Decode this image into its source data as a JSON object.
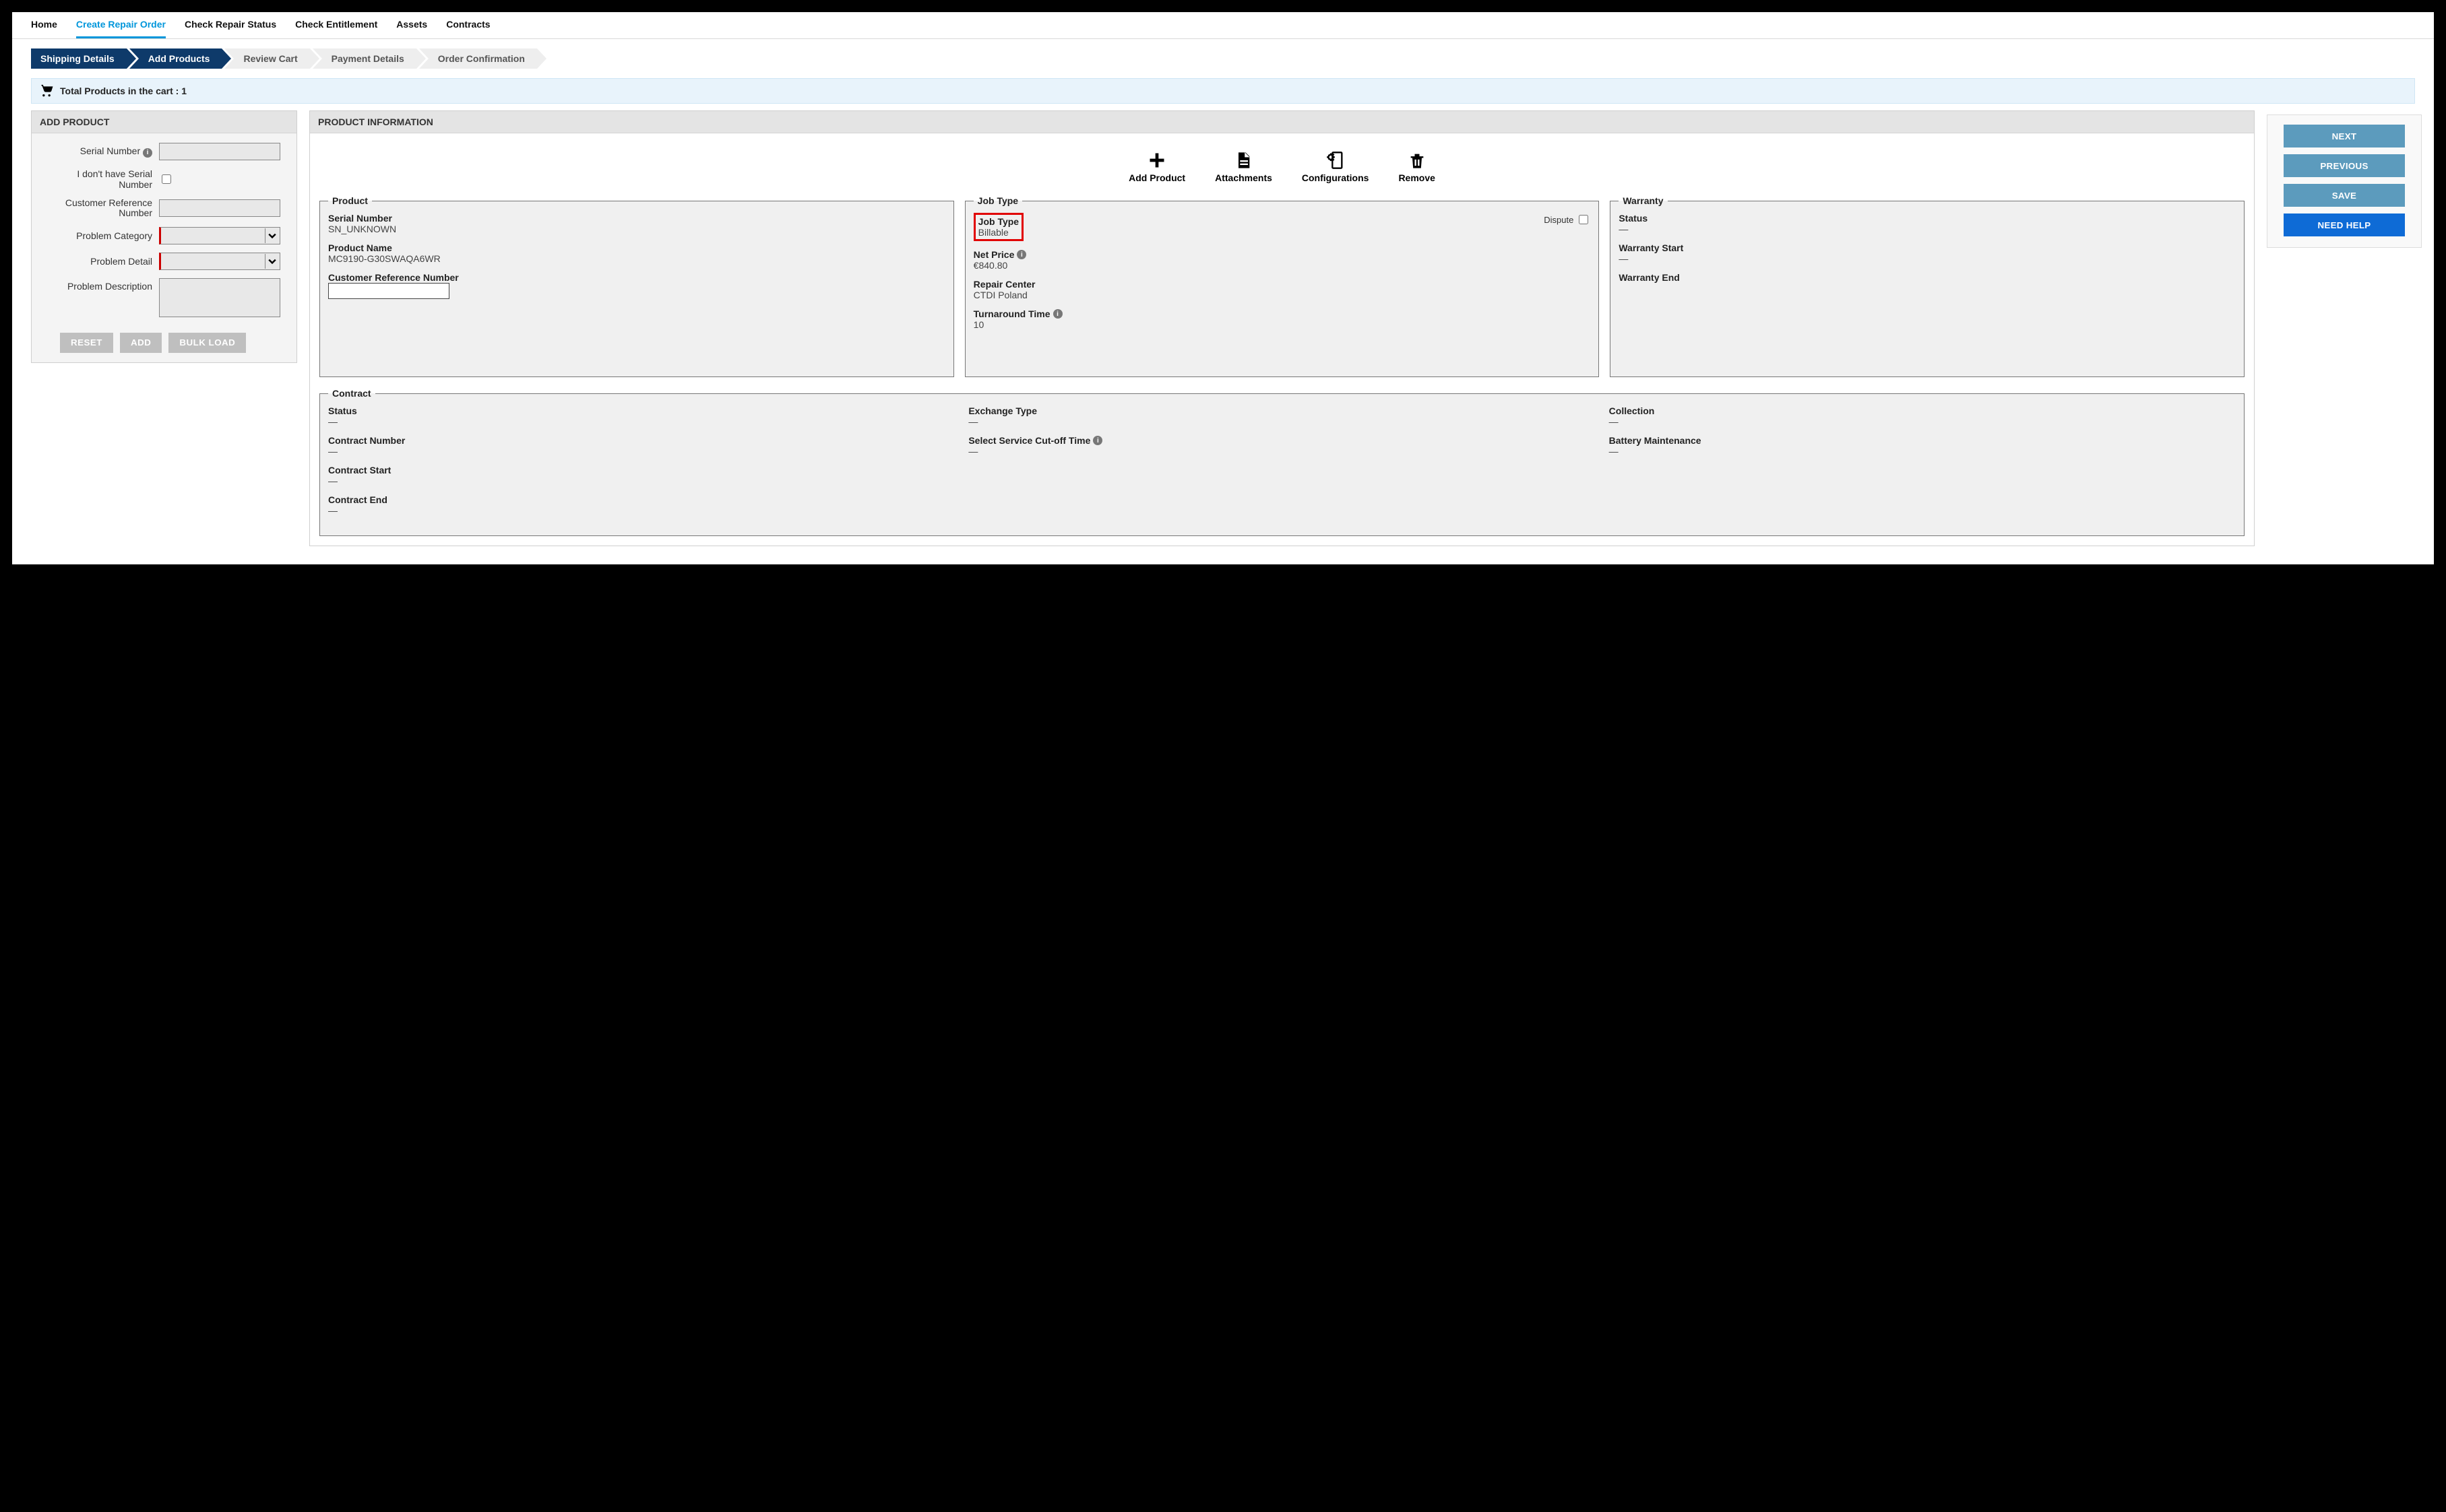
{
  "nav": {
    "home": "Home",
    "create": "Create Repair Order",
    "status": "Check Repair Status",
    "entitlement": "Check Entitlement",
    "assets": "Assets",
    "contracts": "Contracts"
  },
  "wizard": {
    "s1": "Shipping Details",
    "s2": "Add Products",
    "s3": "Review Cart",
    "s4": "Payment Details",
    "s5": "Order Confirmation"
  },
  "cart": {
    "label": "Total Products in the cart : 1"
  },
  "addProduct": {
    "title": "ADD PRODUCT",
    "serialNumberLabel": "Serial Number",
    "noSerialLabel": "I don't have Serial Number",
    "customerRefLabel": "Customer Reference Number",
    "problemCategoryLabel": "Problem Category",
    "problemDetailLabel": "Problem Detail",
    "problemDescriptionLabel": "Problem Description",
    "resetBtn": "RESET",
    "addBtn": "ADD",
    "bulkBtn": "BULK LOAD",
    "serialNumberValue": "",
    "noSerialChecked": false,
    "customerRefValue": "",
    "problemCategoryValue": "",
    "problemDetailValue": "",
    "problemDescriptionValue": ""
  },
  "productInfo": {
    "title": "PRODUCT INFORMATION",
    "tools": {
      "add": "Add Product",
      "attach": "Attachments",
      "config": "Configurations",
      "remove": "Remove"
    },
    "product": {
      "legend": "Product",
      "serialNumberLabel": "Serial Number",
      "serialNumberValue": "SN_UNKNOWN",
      "productNameLabel": "Product Name",
      "productNameValue": "MC9190-G30SWAQA6WR",
      "customerRefLabel": "Customer Reference Number",
      "customerRefValue": ""
    },
    "jobType": {
      "legend": "Job Type",
      "jobTypeLabel": "Job Type",
      "jobTypeValue": "Billable",
      "disputeLabel": "Dispute",
      "netPriceLabel": "Net Price",
      "netPriceValue": "€840.80",
      "repairCenterLabel": "Repair Center",
      "repairCenterValue": "CTDI Poland",
      "turnaroundLabel": "Turnaround Time",
      "turnaroundValue": "10"
    },
    "warranty": {
      "legend": "Warranty",
      "statusLabel": "Status",
      "statusValue": "—",
      "startLabel": "Warranty Start",
      "startValue": "—",
      "endLabel": "Warranty End",
      "endValue": ""
    },
    "contract": {
      "legend": "Contract",
      "statusLabel": "Status",
      "statusValue": "—",
      "exchangeTypeLabel": "Exchange Type",
      "exchangeTypeValue": "—",
      "collectionLabel": "Collection",
      "collectionValue": "—",
      "contractNumberLabel": "Contract Number",
      "contractNumberValue": "—",
      "cutoffLabel": "Select Service Cut-off Time",
      "cutoffValue": "—",
      "batteryLabel": "Battery Maintenance",
      "batteryValue": "—",
      "contractStartLabel": "Contract Start",
      "contractStartValue": "—",
      "contractEndLabel": "Contract End",
      "contractEndValue": "—"
    }
  },
  "actions": {
    "next": "NEXT",
    "previous": "PREVIOUS",
    "save": "SAVE",
    "needHelp": "NEED HELP"
  }
}
